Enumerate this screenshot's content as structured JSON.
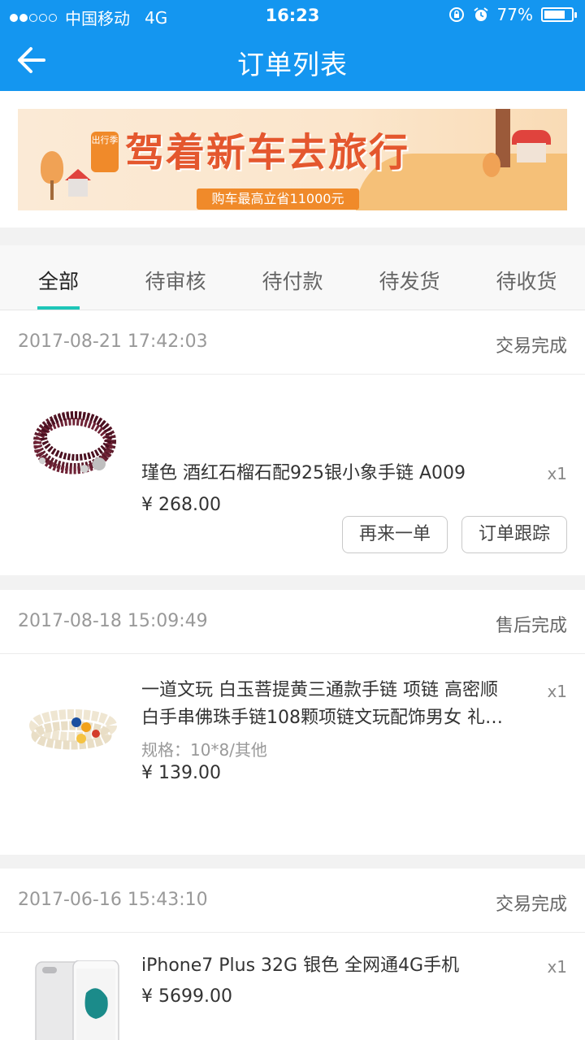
{
  "status_bar": {
    "carrier": "中国移动",
    "network": "4G",
    "time": "16:23",
    "battery": "77%",
    "battery_level": 0.77
  },
  "nav": {
    "title": "订单列表"
  },
  "banner": {
    "badge": "出行季",
    "slogan": "驾着新车去旅行",
    "subtitle": "购车最高立省11000元"
  },
  "tabs": [
    {
      "label": "全部",
      "active": true
    },
    {
      "label": "待审核",
      "active": false
    },
    {
      "label": "待付款",
      "active": false
    },
    {
      "label": "待发货",
      "active": false
    },
    {
      "label": "待收货",
      "active": false
    }
  ],
  "orders": [
    {
      "date": "2017-08-21 17:42:03",
      "status": "交易完成",
      "item": {
        "name": "瑾色 酒红石榴石配925银小象手链 A009",
        "spec": "",
        "price": "¥ 268.00",
        "qty": "x1"
      },
      "buttons": [
        "再来一单",
        "订单跟踪"
      ]
    },
    {
      "date": "2017-08-18 15:09:49",
      "status": "售后完成",
      "item": {
        "name": "一道文玩 白玉菩提黄三通款手链 项链 高密顺白手串佛珠手链108颗项链文玩配饰男女 礼…",
        "spec": "规格：10*8/其他",
        "price": "¥ 139.00",
        "qty": "x1"
      },
      "buttons": []
    },
    {
      "date": "2017-06-16 15:43:10",
      "status": "交易完成",
      "item": {
        "name": "iPhone7 Plus 32G 银色 全网通4G手机",
        "spec": "",
        "price": "¥ 5699.00",
        "qty": "x1"
      },
      "buttons": []
    }
  ],
  "colors": {
    "header": "#1496f0",
    "tab_indicator": "#1ec6b8"
  }
}
